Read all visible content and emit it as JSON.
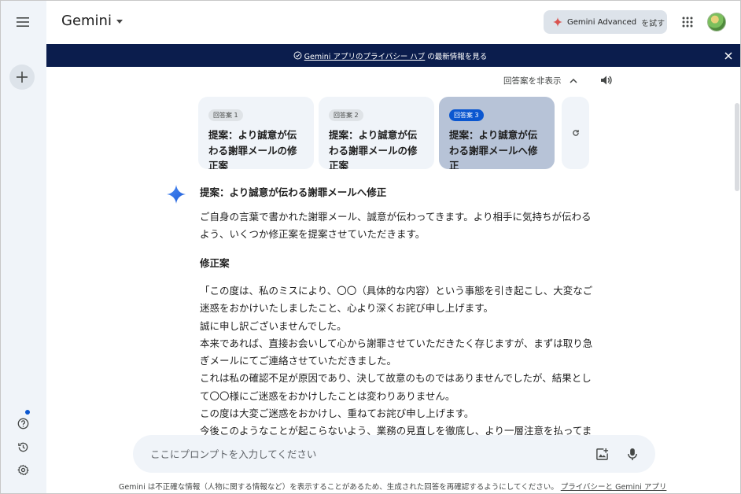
{
  "header": {
    "title": "Gemini",
    "advanced_label": "Gemini Advanced",
    "advanced_try": "を試す"
  },
  "banner": {
    "link_text": "Gemini アプリのプライバシー ハブ",
    "suffix": "の最新情報を見る"
  },
  "drafts": {
    "toggle_label": "回答案を非表示",
    "items": [
      {
        "badge": "回答案 1",
        "text": "提案：より誠意が伝わる謝罪メールの修正案"
      },
      {
        "badge": "回答案 2",
        "text": "提案：より誠意が伝わる謝罪メールの修正案"
      },
      {
        "badge": "回答案 3",
        "text": "提案：より誠意が伝わる謝罪メールへ修正"
      }
    ]
  },
  "response": {
    "title": "提案：より誠意が伝わる謝罪メールへ修正",
    "intro": "ご自身の言葉で書かれた謝罪メール、誠意が伝わってきます。より相手に気持ちが伝わるよう、いくつか修正案を提案させていただきます。",
    "section_title": "修正案",
    "letter_lines": [
      "「この度は、私のミスにより、〇〇（具体的な内容）という事態を引き起こし、大変なご迷惑をおかけいたしましたこと、心より深くお詫び申し上げます。",
      "誠に申し訳ございませんでした。",
      "本来であれば、直接お会いして心から謝罪させていただきたく存じますが、まずは取り急ぎメールにてご連絡させていただきました。",
      "これは私の確認不足が原因であり、決して故意のものではありませんでしたが、結果として〇〇様にご迷惑をおかけしたことは変わりありません。",
      "この度は大変ご迷惑をおかけし、重ねてお詫び申し上げます。",
      "今後このようなことが起こらないよう、業務の見直しを徹底し、より一層注意を払ってまいります。"
    ]
  },
  "prompt": {
    "placeholder": "ここにプロンプトを入力してください"
  },
  "footer": {
    "disclaimer": "Gemini は不正確な情報（人物に関する情報など）を表示することがあるため、生成された回答を再確認するようにしてください。",
    "link": "プライバシーと Gemini アプリ"
  },
  "colors": {
    "accent": "#0b57d0",
    "banner_bg": "#0b1d4d",
    "rail_bg": "#f0f4f9",
    "selected_draft": "#b7c3d7"
  },
  "icons": [
    "menu-icon",
    "plus-icon",
    "help-icon",
    "history-icon",
    "gear-icon",
    "sparkle-icon",
    "apps-grid-icon",
    "shield-check-icon",
    "close-icon",
    "chevron-up-icon",
    "speaker-icon",
    "refresh-icon",
    "add-image-icon",
    "mic-icon"
  ]
}
